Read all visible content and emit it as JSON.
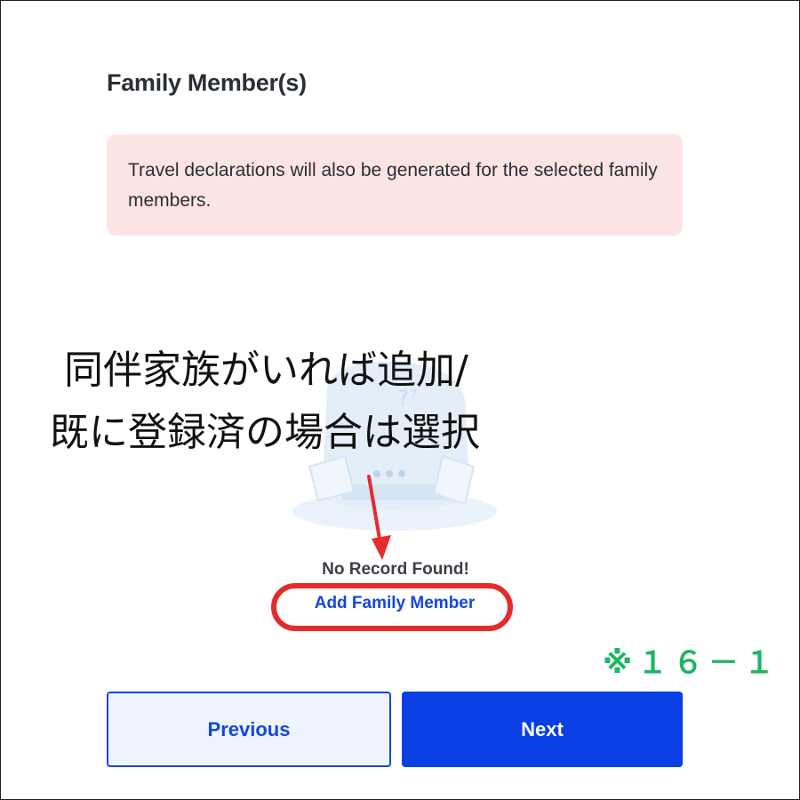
{
  "section": {
    "title": "Family Member(s)"
  },
  "alert": {
    "message": "Travel declarations will also be generated for the selected family members."
  },
  "annotation": {
    "line1": "同伴家族がいれば追加/",
    "line2": "既に登録済の場合は選択",
    "ref_code": "※１６－１"
  },
  "empty_state": {
    "message": "No Record Found!",
    "add_link": "Add Family Member"
  },
  "buttons": {
    "previous": "Previous",
    "next": "Next"
  },
  "colors": {
    "primary": "#0a3fe4",
    "alert_bg": "#fce4e4",
    "annotation_red": "#e52b2b",
    "annotation_green": "#20b566"
  }
}
